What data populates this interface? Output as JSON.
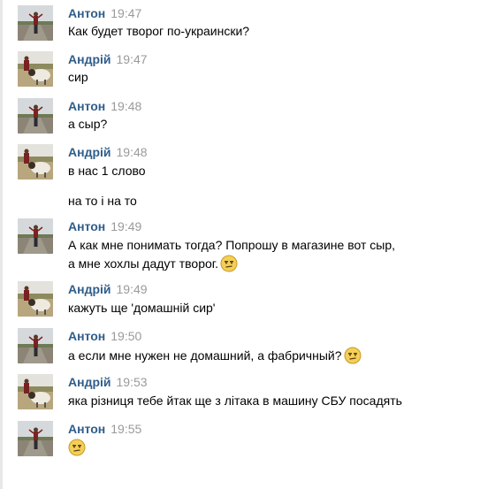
{
  "messages": [
    {
      "author": "Антон",
      "time": "19:47",
      "lines": [
        "Как будет творог по-украински?"
      ]
    },
    {
      "author": "Андрій",
      "time": "19:47",
      "lines": [
        "сир"
      ]
    },
    {
      "author": "Антон",
      "time": "19:48",
      "lines": [
        "а сыр?"
      ]
    },
    {
      "author": "Андрій",
      "time": "19:48",
      "lines": [
        "в нас 1 слово",
        "на то і на то"
      ]
    },
    {
      "author": "Антон",
      "time": "19:49",
      "lines": [
        "А как мне понимать тогда? Попрошу в магазине вот сыр,",
        "а мне хохлы дадут творог."
      ]
    },
    {
      "author": "Андрій",
      "time": "19:49",
      "lines": [
        "кажуть ще 'домашній сир'"
      ]
    },
    {
      "author": "Антон",
      "time": "19:50",
      "lines": [
        "а если мне нужен не домашний, а фабричный?"
      ]
    },
    {
      "author": "Андрій",
      "time": "19:53",
      "lines": [
        "яка різниця тебе йтак ще з літака в машину СБУ посадять"
      ]
    },
    {
      "author": "Антон",
      "time": "19:55",
      "lines": []
    }
  ],
  "icons": {
    "avatar_anton": "avatar-anton-photo",
    "avatar_andriy": "avatar-andriy-photo",
    "emoji": "confused-face-emoji"
  },
  "colors": {
    "author": "#2f5d8a",
    "time": "#9a9a9a",
    "text": "#000000",
    "background": "#ffffff"
  }
}
